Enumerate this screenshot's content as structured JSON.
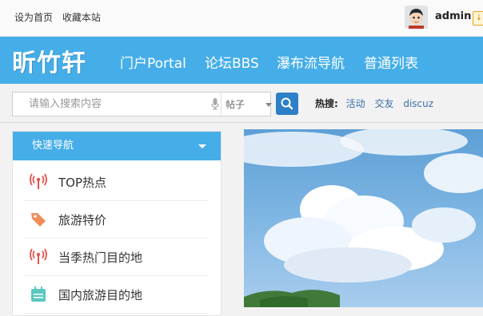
{
  "topbar": {
    "links": [
      "设为首页",
      "收藏本站"
    ],
    "username": "admin",
    "badge": "↓"
  },
  "nav": {
    "logo": "昕竹轩",
    "items": [
      "门户Portal",
      "论坛BBS",
      "瀑布流导航",
      "普通列表"
    ]
  },
  "search": {
    "placeholder": "请输入搜索内容",
    "type": "帖子",
    "hot_label": "热搜:",
    "hot_keywords": [
      "活动",
      "交友",
      "discuz"
    ]
  },
  "sidebar": {
    "title": "快速导航",
    "items": [
      {
        "label": "TOP热点",
        "icon": "broadcast-icon"
      },
      {
        "label": "旅游特价",
        "icon": "tag-icon"
      },
      {
        "label": "当季热门目的地",
        "icon": "broadcast-icon"
      },
      {
        "label": "国内旅游目的地",
        "icon": "calendar-icon"
      }
    ]
  },
  "colors": {
    "primary": "#45aee8",
    "search_button": "#2d7fc7",
    "icon_red": "#e8534a",
    "icon_orange": "#f08d5a",
    "icon_teal": "#5cc8c0"
  }
}
